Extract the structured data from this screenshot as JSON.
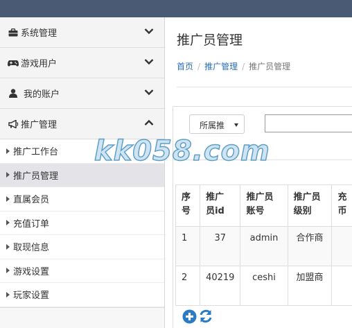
{
  "sidebar": {
    "menus": [
      {
        "label": "系统管理",
        "icon": "briefcase-icon",
        "expanded": false
      },
      {
        "label": "游戏用户",
        "icon": "gamepad-icon",
        "expanded": false
      },
      {
        "label": "我的账户",
        "icon": "user-icon",
        "expanded": false
      },
      {
        "label": "推广管理",
        "icon": "bullhorn-icon",
        "expanded": true
      }
    ],
    "subitems": [
      {
        "label": "推广工作台",
        "active": false
      },
      {
        "label": "推广员管理",
        "active": true
      },
      {
        "label": "直属会员",
        "active": false
      },
      {
        "label": "充值订单",
        "active": false
      },
      {
        "label": "取现信息",
        "active": false
      },
      {
        "label": "游戏设置",
        "active": false
      },
      {
        "label": "玩家设置",
        "active": false
      }
    ]
  },
  "main": {
    "title": "推广员管理",
    "breadcrumb": [
      "首页",
      "推广管理",
      "推广员管理"
    ]
  },
  "filter": {
    "select_value": "所属推",
    "search_value": ""
  },
  "table": {
    "headers": [
      [
        "序",
        "号"
      ],
      [
        "推广",
        "员id"
      ],
      [
        "推广员",
        "账号"
      ],
      [
        "推广员",
        "级别"
      ],
      [
        "充",
        "币"
      ]
    ],
    "rows": [
      [
        "1",
        "37",
        "admin",
        "合作商",
        ""
      ],
      [
        "2",
        "40219",
        "ceshi",
        "加盟商",
        ""
      ]
    ]
  },
  "actions": [
    {
      "icon": "plus-circle-icon",
      "color": "#2a7bc4"
    },
    {
      "icon": "refresh-icon",
      "color": "#2a7bc4"
    }
  ],
  "watermark": "kk058.com",
  "colors": {
    "topbar": "#4b5a74",
    "link": "#2a6ebb",
    "icon_blue": "#2a7bc4",
    "active_item": "#e4e4e8"
  }
}
